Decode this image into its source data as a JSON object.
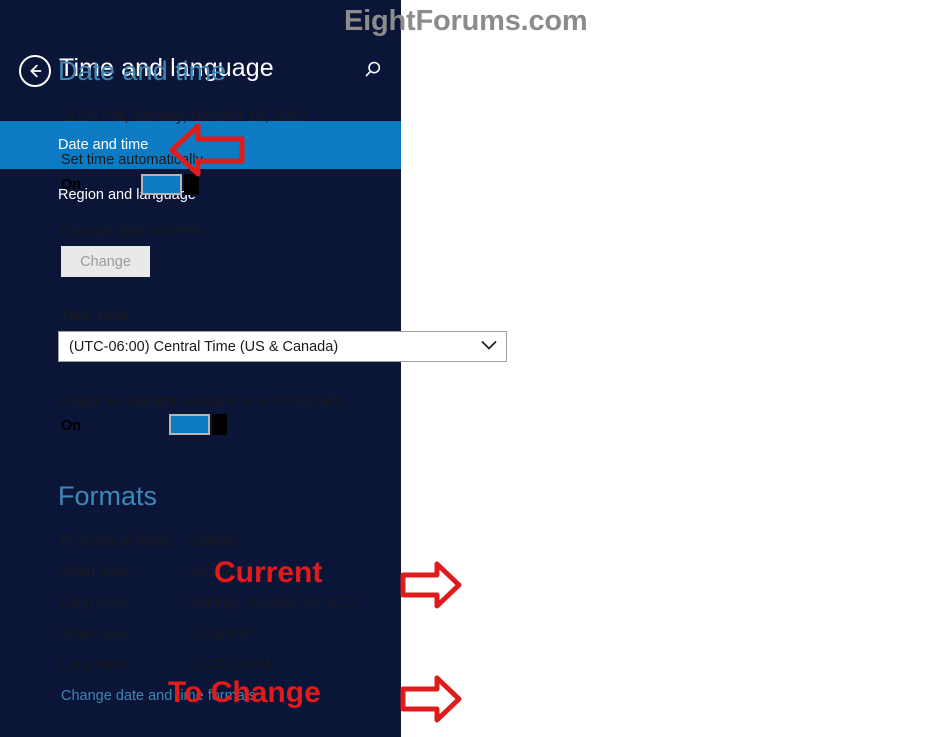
{
  "watermark": "EightForums.com",
  "window": {
    "title": "Time and language",
    "back_icon": "back-arrow-icon",
    "search_icon": "search-icon"
  },
  "sidebar": {
    "items": [
      {
        "label": "Date and time",
        "selected": true
      },
      {
        "label": "Region and language",
        "selected": false
      }
    ]
  },
  "main": {
    "date_time_heading": "Date and time",
    "current_datetime": "11:26 PM, Sunday, October 13, 2013",
    "set_time_automatically": {
      "label": "Set time automatically",
      "state": "On"
    },
    "change_date_and_time": {
      "label": "Change date and time",
      "button_label": "Change"
    },
    "time_zone": {
      "label": "Time zone",
      "selected": "(UTC-06:00) Central Time (US & Canada)"
    },
    "daylight_saving": {
      "label": "Adjust for daylight saving time automatically",
      "state": "On"
    },
    "formats_heading": "Formats",
    "formats": [
      {
        "label": "First day of week:",
        "value": "Sunday"
      },
      {
        "label": "Short date:",
        "value": "10/13/2013"
      },
      {
        "label": "Long date:",
        "value": "Sunday, October 13, 2013"
      },
      {
        "label": "Short time:",
        "value": "11:26 PM"
      },
      {
        "label": "Long time:",
        "value": "11:26:37 PM"
      }
    ],
    "change_formats_link": "Change date and time formats"
  },
  "annotations": {
    "current": "Current",
    "to_change": "To Change"
  },
  "colors": {
    "sidebar_background": "#0b1538",
    "accent_blue": "#0d7ac4",
    "heading_blue": "#3f87b5",
    "annotation_red": "#e01b1b",
    "watermark_gray": "#8c8c8c"
  }
}
